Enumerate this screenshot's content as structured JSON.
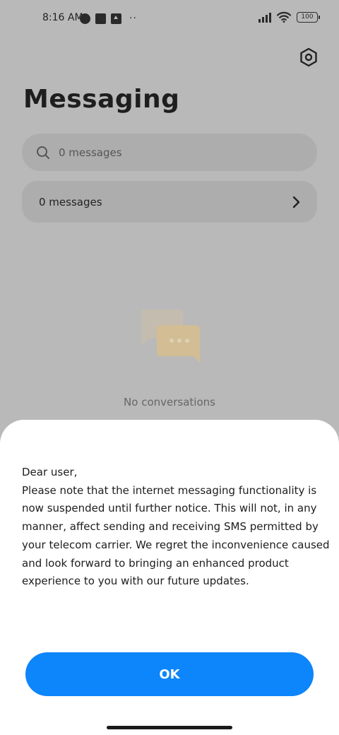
{
  "status_bar": {
    "time": "8:16 AM",
    "battery": "100",
    "overflow": "··"
  },
  "header": {
    "title": "Messaging",
    "settings_icon": "settings-icon"
  },
  "search": {
    "placeholder": "0 messages"
  },
  "messages_row": {
    "label": "0 messages"
  },
  "empty_state": {
    "text": "No conversations"
  },
  "dialog": {
    "greeting": "Dear user,",
    "body": "Please note that the internet messaging functionality is now suspended until further notice. This will not, in any manner, affect sending and receiving SMS permitted by your telecom carrier. We regret the inconvenience caused and look forward to bringing an enhanced product experience to you with our future updates.",
    "ok_label": "OK"
  },
  "colors": {
    "overlay": "#b9b9b9",
    "accent": "#0d85fb",
    "sheet": "#ffffff"
  }
}
